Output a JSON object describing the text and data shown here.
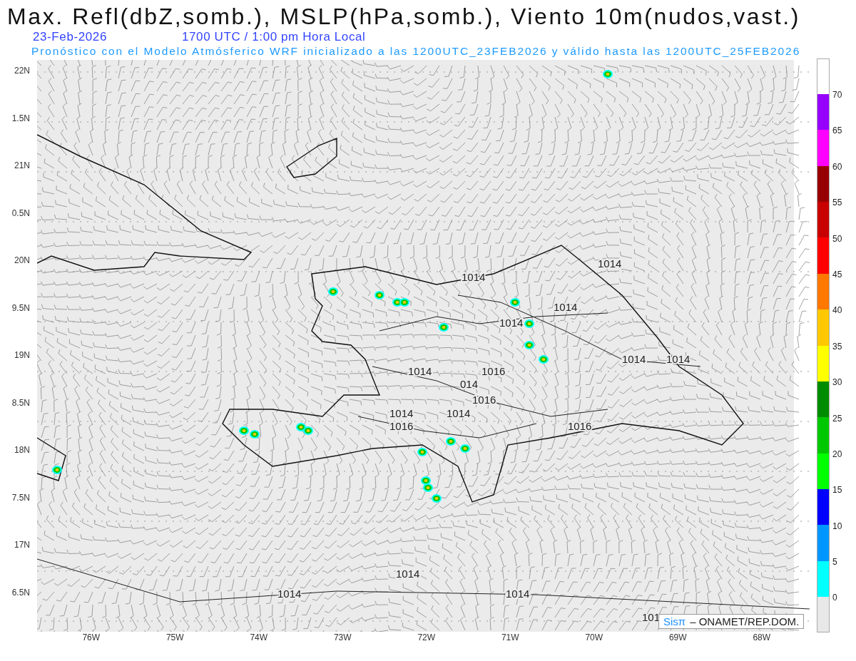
{
  "title": "Max. Refl(dbZ,somb.), MSLP(hPa,somb.), Viento 10m(nudos,vast.)",
  "date": "23-Feb-2026",
  "time": "1700 UTC / 1:00 pm Hora Local",
  "forecast_note": "Pronóstico con el Modelo Atmósferico WRF inicializado a las 1200UTC_23FEB2026 y válido hasta las  1200UTC_25FEB2026",
  "y_axis": [
    "22N",
    "1.5N",
    "21N",
    "0.5N",
    "20N",
    "9.5N",
    "19N",
    "8.5N",
    "18N",
    "7.5N",
    "17N",
    "6.5N"
  ],
  "x_axis": [
    "76W",
    "75W",
    "74W",
    "73W",
    "72W",
    "71W",
    "70W",
    "69W",
    "68W"
  ],
  "isobar_labels": [
    "1014",
    "1014",
    "1014",
    "1014",
    "1014",
    "1014",
    "1014",
    "1016",
    "014",
    "1016",
    "1014",
    "1014",
    "1016",
    "1016",
    "1014",
    "1014",
    "1014",
    "101"
  ],
  "credit": {
    "logo": "Sisπ",
    "text": "– ONAMET/REP.DOM."
  },
  "colorbar": {
    "ticks": [
      "70",
      "65",
      "60",
      "55",
      "50",
      "45",
      "40",
      "35",
      "30",
      "25",
      "20",
      "15",
      "10",
      "5",
      "0"
    ],
    "bands": [
      {
        "color": "#9600ff"
      },
      {
        "color": "#ff00ff"
      },
      {
        "color": "#960000"
      },
      {
        "color": "#c80000"
      },
      {
        "color": "#ff0000"
      },
      {
        "color": "#ff7800"
      },
      {
        "color": "#ffc800"
      },
      {
        "color": "#ffff00"
      },
      {
        "color": "#008c00"
      },
      {
        "color": "#00c800"
      },
      {
        "color": "#00ff00"
      },
      {
        "color": "#0000ff"
      },
      {
        "color": "#0096ff"
      },
      {
        "color": "#00ffff"
      }
    ]
  }
}
